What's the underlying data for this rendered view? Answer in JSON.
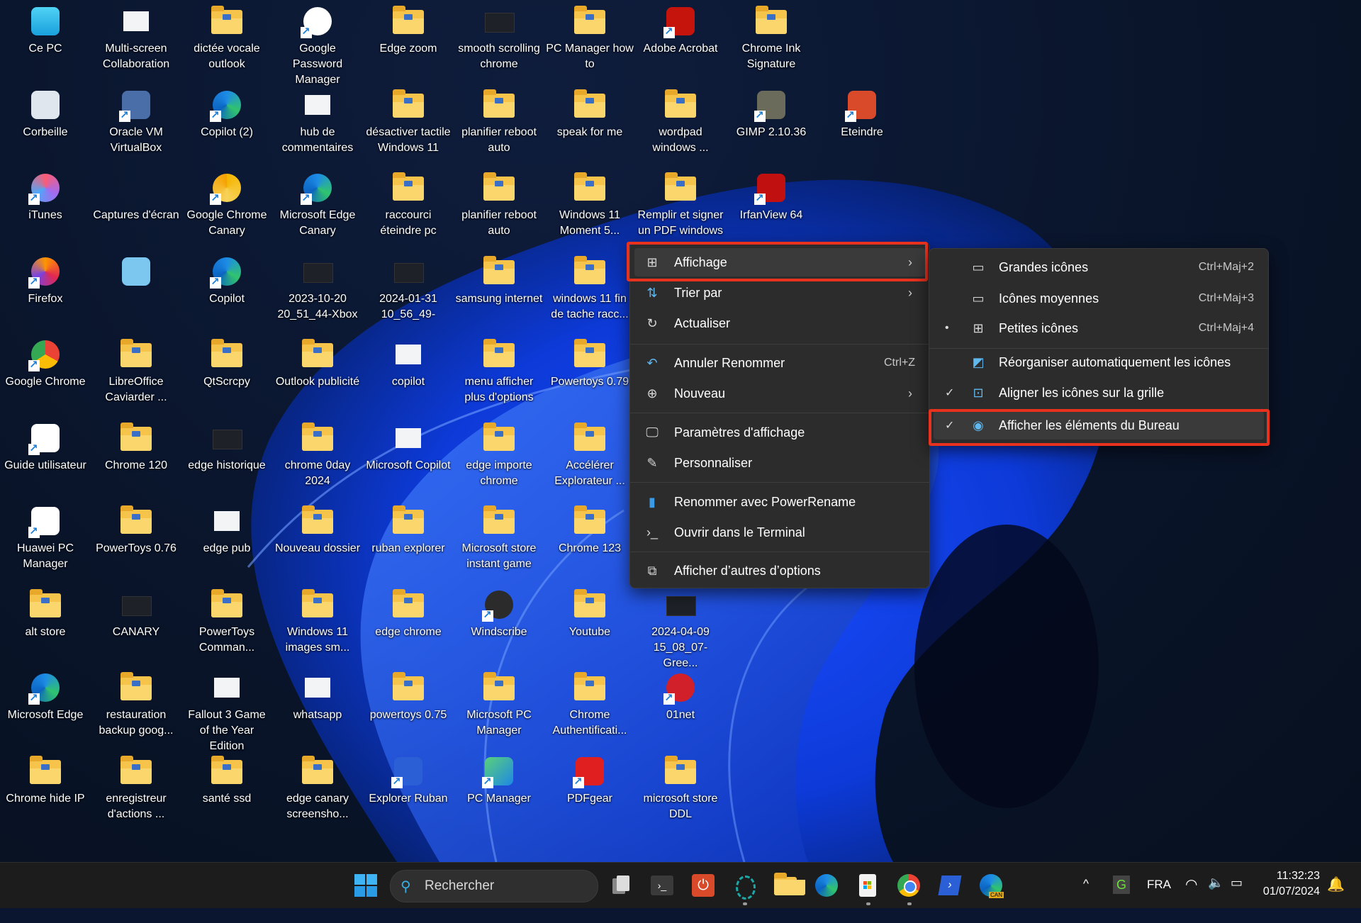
{
  "desktop": {
    "columns": [
      [
        "Ce PC",
        "Corbeille",
        "iTunes",
        "Firefox",
        "Google Chrome",
        "Guide utilisateur",
        "Huawei PC Manager",
        "alt store",
        "Microsoft Edge",
        "Chrome hide IP"
      ],
      [
        "Multi-screen Collaboration",
        "Oracle VM VirtualBox",
        "Captures d'écran",
        "",
        "LibreOffice Caviarder ...",
        "Chrome 120",
        "PowerToys 0.76",
        "CANARY",
        "restauration backup goog...",
        "enregistreur d'actions ..."
      ],
      [
        "dictée vocale outlook",
        "Copilot (2)",
        "Google Chrome Canary",
        "Copilot",
        "QtScrcpy",
        "edge historique",
        "edge pub",
        "PowerToys Comman...",
        "Fallout 3 Game of the Year Edition",
        "santé ssd"
      ],
      [
        "Google Password Manager",
        "hub de commentaires",
        "Microsoft Edge Canary",
        "2023-10-20 20_51_44-Xbox",
        "Outlook publicité",
        "chrome 0day 2024",
        "Nouveau dossier",
        "Windows 11 images sm...",
        "whatsapp",
        "edge canary screensho..."
      ],
      [
        "Edge zoom",
        "désactiver tactile Windows 11",
        "raccourci éteindre pc",
        "2024-01-31 10_56_49-",
        "copilot",
        "Microsoft Copilot",
        "ruban explorer",
        "edge chrome",
        "powertoys 0.75",
        "Explorer Ruban"
      ],
      [
        "smooth scrolling chrome",
        "planifier reboot auto",
        "planifier reboot auto",
        "samsung internet",
        "menu afficher plus d'options",
        "edge importe chrome",
        "Microsoft store instant game",
        "Windscribe",
        "Microsoft PC Manager",
        "PC Manager"
      ],
      [
        "PC Manager how to",
        "speak for me",
        "Windows 11 Moment 5...",
        "windows 11 fin de tache racc...",
        "Powertoys 0.79",
        "Accélérer Explorateur ...",
        "Chrome 123",
        "Youtube",
        "Chrome Authentificati...",
        "PDFgear"
      ],
      [
        "Adobe Acrobat",
        "wordpad windows ...",
        "Remplir et signer un PDF windows",
        "",
        "",
        "",
        "",
        "2024-04-09 15_08_07-Gree...",
        "01net",
        "microsoft store DDL"
      ],
      [
        "Chrome Ink Signature",
        "GIMP 2.10.36",
        "IrfanView 64",
        "",
        "",
        "",
        "",
        "",
        "",
        ""
      ],
      [
        "",
        "Eteindre",
        "",
        "",
        "",
        "",
        "",
        "",
        "",
        ""
      ]
    ]
  },
  "context_menu": {
    "items": [
      {
        "label": "Affichage",
        "icon": "grid-icon",
        "submenu": true
      },
      {
        "label": "Trier par",
        "icon": "sort-icon",
        "submenu": true
      },
      {
        "label": "Actualiser",
        "icon": "refresh-icon"
      },
      {
        "label": "Annuler Renommer",
        "icon": "undo-icon",
        "shortcut": "Ctrl+Z"
      },
      {
        "label": "Nouveau",
        "icon": "plus-circle-icon",
        "submenu": true
      },
      {
        "label": "Paramètres d'affichage",
        "icon": "display-settings-icon"
      },
      {
        "label": "Personnaliser",
        "icon": "brush-icon"
      },
      {
        "label": "Renommer avec PowerRename",
        "icon": "powerrename-icon"
      },
      {
        "label": "Ouvrir dans le Terminal",
        "icon": "terminal-icon"
      },
      {
        "label": "Afficher d’autres d’options",
        "icon": "more-options-icon"
      }
    ]
  },
  "submenu": {
    "items": [
      {
        "label": "Grandes icônes",
        "shortcut": "Ctrl+Maj+2",
        "mark": ""
      },
      {
        "label": "Icônes moyennes",
        "shortcut": "Ctrl+Maj+3",
        "mark": ""
      },
      {
        "label": "Petites icônes",
        "shortcut": "Ctrl+Maj+4",
        "mark": "•"
      },
      {
        "label": "Réorganiser automatiquement les icônes",
        "shortcut": "",
        "mark": ""
      },
      {
        "label": "Aligner les icônes sur la grille",
        "shortcut": "",
        "mark": "✓"
      },
      {
        "label": "Afficher les éléments du Bureau",
        "shortcut": "",
        "mark": "✓"
      }
    ]
  },
  "taskbar": {
    "search_placeholder": "Rechercher",
    "language": "FRA",
    "time": "11:32:23",
    "date": "01/07/2024"
  },
  "colors": {
    "highlight": "#e8321e",
    "folder": "#f6c44a",
    "accent": "#3ab0e0"
  }
}
